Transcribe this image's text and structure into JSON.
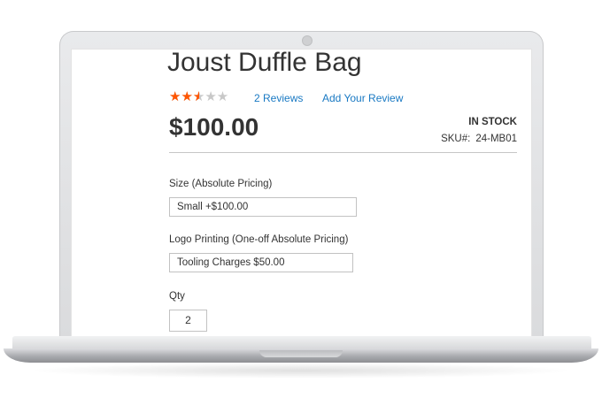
{
  "product": {
    "title": "Joust Duffle Bag",
    "rating": 0.5,
    "stars_glyphs": "★★★★★",
    "reviews_link": "2 Reviews",
    "add_review_link": "Add Your Review",
    "price": "$100.00",
    "stock_status": "In stock",
    "sku_label": "SKU#:",
    "sku_value": "24-MB01"
  },
  "options": {
    "size": {
      "label": "Size (Absolute Pricing)",
      "selected": "Small +$100.00"
    },
    "logo": {
      "label": "Logo Printing (One-off Absolute Pricing)",
      "selected": "Tooling Charges $50.00"
    }
  },
  "qty": {
    "label": "Qty",
    "value": "2"
  },
  "colors": {
    "star_filled": "#ff5501",
    "star_empty": "#c8c8c8",
    "link": "#1979c3",
    "text": "#333333"
  }
}
